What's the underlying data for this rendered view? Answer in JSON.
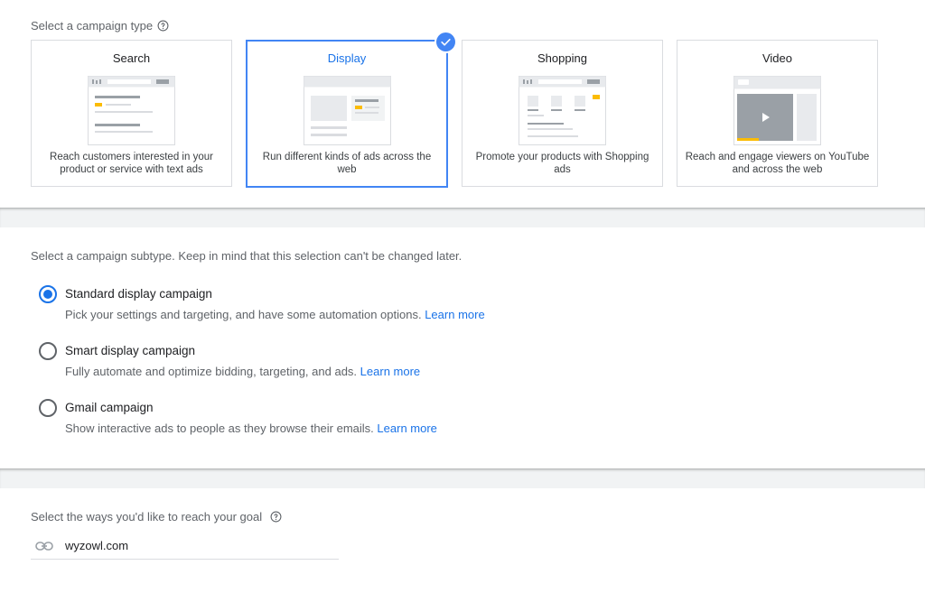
{
  "type_section": {
    "label": "Select a campaign type",
    "cards": [
      {
        "title": "Search",
        "description": "Reach customers interested in your product or service with text ads",
        "selected": false
      },
      {
        "title": "Display",
        "description": "Run different kinds of ads across the web",
        "selected": true
      },
      {
        "title": "Shopping",
        "description": "Promote your products with Shopping ads",
        "selected": false
      },
      {
        "title": "Video",
        "description": "Reach and engage viewers on YouTube and across the web",
        "selected": false
      }
    ]
  },
  "subtype_section": {
    "label": "Select a campaign subtype. Keep in mind that this selection can't be changed later.",
    "options": [
      {
        "title": "Standard display campaign",
        "description": "Pick your settings and targeting, and have some automation options.",
        "link": "Learn more",
        "checked": true
      },
      {
        "title": "Smart display campaign",
        "description": "Fully automate and optimize bidding, targeting, and ads.",
        "link": "Learn more",
        "checked": false
      },
      {
        "title": "Gmail campaign",
        "description": "Show interactive ads to people as they browse their emails.",
        "link": "Learn more",
        "checked": false
      }
    ]
  },
  "goal_section": {
    "label": "Select the ways you'd like to reach your goal",
    "website": "wyzowl.com"
  },
  "colors": {
    "accent": "#1a73e8",
    "selected_border": "#4285f4",
    "illustration_yellow": "#fbbc04"
  },
  "icons": {
    "help": "help-circle-icon",
    "check": "check-circle-icon",
    "link": "link-icon"
  }
}
